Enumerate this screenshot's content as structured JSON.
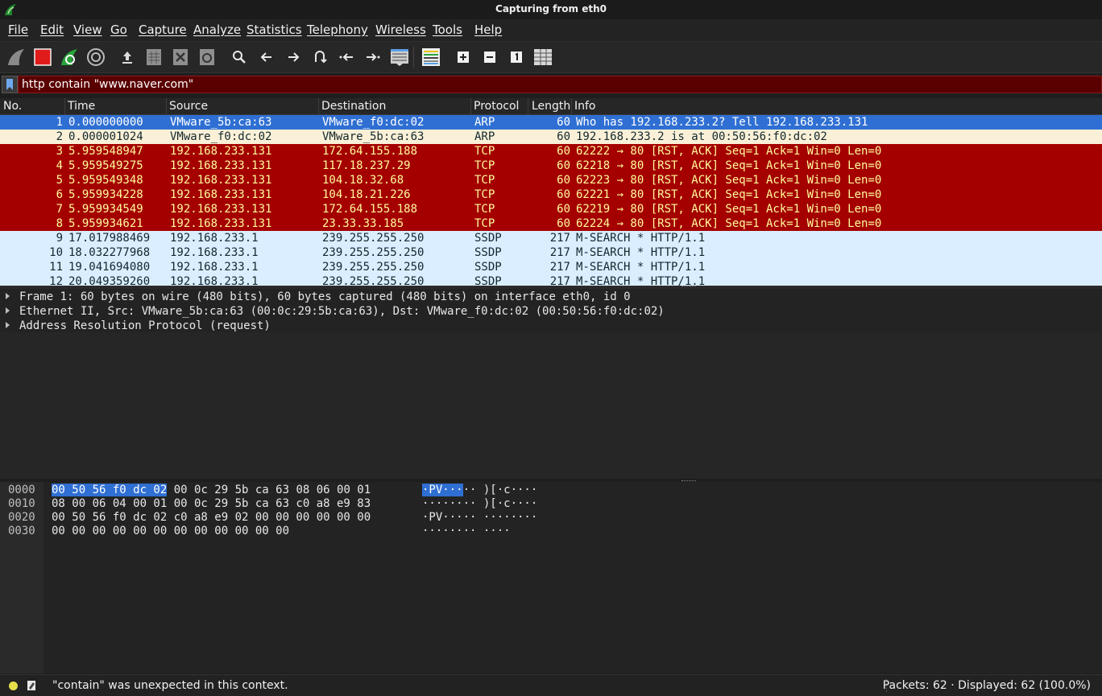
{
  "window": {
    "title": "Capturing from eth0"
  },
  "menu": [
    "File",
    "Edit",
    "View",
    "Go",
    "Capture",
    "Analyze",
    "Statistics",
    "Telephony",
    "Wireless",
    "Tools",
    "Help"
  ],
  "toolbar": {
    "buttons": [
      {
        "name": "start-capture-icon"
      },
      {
        "name": "stop-capture-icon"
      },
      {
        "name": "restart-capture-icon"
      },
      {
        "name": "capture-options-icon"
      },
      {
        "name": "open-file-icon"
      },
      {
        "name": "save-file-icon"
      },
      {
        "name": "close-file-icon"
      },
      {
        "name": "reload-file-icon"
      },
      {
        "name": "find-packet-icon"
      },
      {
        "name": "go-back-icon"
      },
      {
        "name": "go-forward-icon"
      },
      {
        "name": "go-to-packet-icon"
      },
      {
        "name": "go-first-packet-icon"
      },
      {
        "name": "go-last-packet-icon"
      },
      {
        "name": "autoscroll-icon"
      },
      {
        "name": "colorize-icon"
      },
      {
        "name": "zoom-in-icon"
      },
      {
        "name": "zoom-out-icon"
      },
      {
        "name": "normal-size-icon"
      },
      {
        "name": "resize-columns-icon"
      }
    ]
  },
  "filter": {
    "value": "http contain \"www.naver.com\""
  },
  "packet_list": {
    "columns": [
      "No.",
      "Time",
      "Source",
      "Destination",
      "Protocol",
      "Length",
      "Info"
    ],
    "rows": [
      {
        "no": "1",
        "time": "0.000000000",
        "src": "VMware_5b:ca:63",
        "dst": "VMware_f0:dc:02",
        "proto": "ARP",
        "len": "60",
        "info": "Who has 192.168.233.2? Tell 192.168.233.131",
        "bg": "#2f6fd3",
        "fg": "#ffffff"
      },
      {
        "no": "2",
        "time": "0.000001024",
        "src": "VMware_f0:dc:02",
        "dst": "VMware_5b:ca:63",
        "proto": "ARP",
        "len": "60",
        "info": "192.168.233.2 is at 00:50:56:f0:dc:02",
        "bg": "#faf0d7",
        "fg": "#12272e"
      },
      {
        "no": "3",
        "time": "5.959548947",
        "src": "192.168.233.131",
        "dst": "172.64.155.188",
        "proto": "TCP",
        "len": "60",
        "info": "62222 → 80 [RST, ACK] Seq=1 Ack=1 Win=0 Len=0",
        "bg": "#a40000",
        "fg": "#fffc9c"
      },
      {
        "no": "4",
        "time": "5.959549275",
        "src": "192.168.233.131",
        "dst": "117.18.237.29",
        "proto": "TCP",
        "len": "60",
        "info": "62218 → 80 [RST, ACK] Seq=1 Ack=1 Win=0 Len=0",
        "bg": "#a40000",
        "fg": "#fffc9c"
      },
      {
        "no": "5",
        "time": "5.959549348",
        "src": "192.168.233.131",
        "dst": "104.18.32.68",
        "proto": "TCP",
        "len": "60",
        "info": "62223 → 80 [RST, ACK] Seq=1 Ack=1 Win=0 Len=0",
        "bg": "#a40000",
        "fg": "#fffc9c"
      },
      {
        "no": "6",
        "time": "5.959934228",
        "src": "192.168.233.131",
        "dst": "104.18.21.226",
        "proto": "TCP",
        "len": "60",
        "info": "62221 → 80 [RST, ACK] Seq=1 Ack=1 Win=0 Len=0",
        "bg": "#a40000",
        "fg": "#fffc9c"
      },
      {
        "no": "7",
        "time": "5.959934549",
        "src": "192.168.233.131",
        "dst": "172.64.155.188",
        "proto": "TCP",
        "len": "60",
        "info": "62219 → 80 [RST, ACK] Seq=1 Ack=1 Win=0 Len=0",
        "bg": "#a40000",
        "fg": "#fffc9c"
      },
      {
        "no": "8",
        "time": "5.959934621",
        "src": "192.168.233.131",
        "dst": "23.33.33.185",
        "proto": "TCP",
        "len": "60",
        "info": "62224 → 80 [RST, ACK] Seq=1 Ack=1 Win=0 Len=0",
        "bg": "#a40000",
        "fg": "#fffc9c"
      },
      {
        "no": "9",
        "time": "17.017988469",
        "src": "192.168.233.1",
        "dst": "239.255.255.250",
        "proto": "SSDP",
        "len": "217",
        "info": "M-SEARCH * HTTP/1.1",
        "bg": "#daeeff",
        "fg": "#12272e"
      },
      {
        "no": "10",
        "time": "18.032277968",
        "src": "192.168.233.1",
        "dst": "239.255.255.250",
        "proto": "SSDP",
        "len": "217",
        "info": "M-SEARCH * HTTP/1.1",
        "bg": "#daeeff",
        "fg": "#12272e"
      },
      {
        "no": "11",
        "time": "19.041694080",
        "src": "192.168.233.1",
        "dst": "239.255.255.250",
        "proto": "SSDP",
        "len": "217",
        "info": "M-SEARCH * HTTP/1.1",
        "bg": "#daeeff",
        "fg": "#12272e"
      },
      {
        "no": "12",
        "time": "20.049359260",
        "src": "192.168.233.1",
        "dst": "239.255.255.250",
        "proto": "SSDP",
        "len": "217",
        "info": "M-SEARCH * HTTP/1.1",
        "bg": "#daeeff",
        "fg": "#12272e"
      }
    ]
  },
  "details": [
    "Frame 1: 60 bytes on wire (480 bits), 60 bytes captured (480 bits) on interface eth0, id 0",
    "Ethernet II, Src: VMware_5b:ca:63 (00:0c:29:5b:ca:63), Dst: VMware_f0:dc:02 (00:50:56:f0:dc:02)",
    "Address Resolution Protocol (request)"
  ],
  "bytes": [
    {
      "offset": "0000",
      "hex_sel": "00 50 56 f0 dc 02",
      "hex_rest": " 00 0c  29 5b ca 63 08 06 00 01",
      "ascii_sel": "·PV···",
      "ascii_rest": "·· )[·c····"
    },
    {
      "offset": "0010",
      "hex_sel": "",
      "hex_rest": "08 00 06 04 00 01 00 0c  29 5b ca 63 c0 a8 e9 83",
      "ascii_sel": "",
      "ascii_rest": "········ )[·c····"
    },
    {
      "offset": "0020",
      "hex_sel": "",
      "hex_rest": "00 50 56 f0 dc 02 c0 a8  e9 02 00 00 00 00 00 00",
      "ascii_sel": "",
      "ascii_rest": "·PV····· ········"
    },
    {
      "offset": "0030",
      "hex_sel": "",
      "hex_rest": "00 00 00 00 00 00 00 00  00 00 00 00",
      "ascii_sel": "",
      "ascii_rest": "········ ····"
    }
  ],
  "status": {
    "message": "\"contain\" was unexpected in this context.",
    "packets": "Packets: 62 · Displayed: 62 (100.0%)"
  }
}
